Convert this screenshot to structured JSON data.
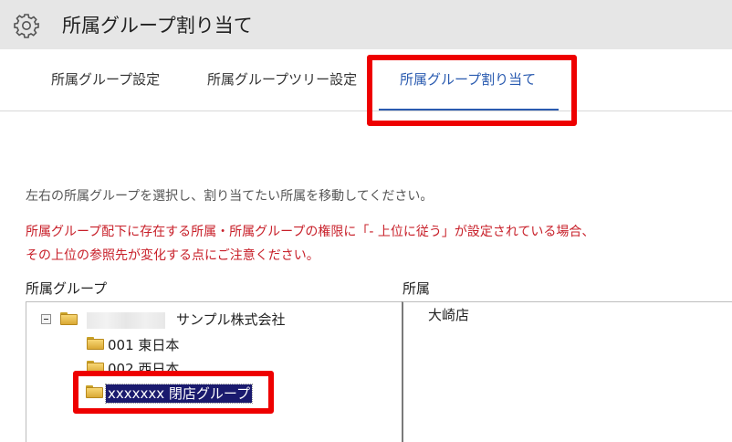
{
  "header": {
    "title": "所属グループ割り当て",
    "icon": "gear-icon"
  },
  "tabs": [
    {
      "label": "所属グループ設定",
      "active": false
    },
    {
      "label": "所属グループツリー設定",
      "active": false
    },
    {
      "label": "所属グループ割り当て",
      "active": true
    }
  ],
  "colors": {
    "active_tab": "#2a5bb0",
    "warning": "#c8202a",
    "highlight": "#ee0000",
    "selection": "#1a1a6e"
  },
  "instructions": {
    "description": "左右の所属グループを選択し、割り当てたい所属を移動してください。",
    "warning_line1": "所属グループ配下に存在する所属・所属グループの権限に「- 上位に従う」が設定されている場合、",
    "warning_line2": "その上位の参照先が変化する点にご注意ください。"
  },
  "group_panel": {
    "label": "所属グループ",
    "tree": {
      "root": {
        "label": "サンプル株式会社",
        "expanded": true,
        "icon": "folder-icon"
      },
      "children": [
        {
          "label": "001 東日本",
          "icon": "folder-icon"
        },
        {
          "label": "002 西日本",
          "icon": "folder-icon"
        },
        {
          "label": "xxxxxxx 閉店グループ",
          "icon": "folder-icon",
          "selected": true
        }
      ]
    }
  },
  "department_panel": {
    "label": "所属",
    "items": [
      "大崎店"
    ]
  }
}
